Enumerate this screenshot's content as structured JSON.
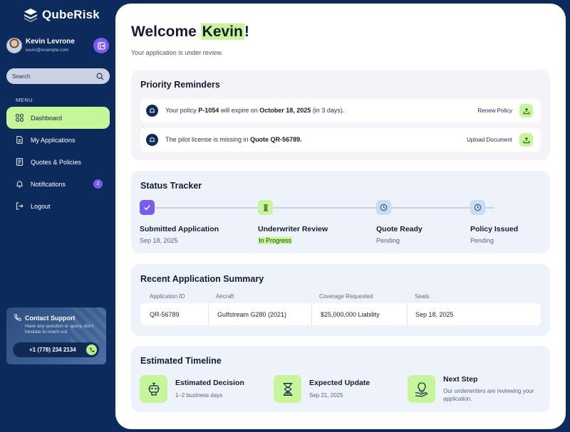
{
  "brand": {
    "name": "QubeRisk"
  },
  "user": {
    "name": "Kevin Levrone",
    "email": "kevin@example.com"
  },
  "search": {
    "placeholder": "Search"
  },
  "menu": {
    "label": "MENU",
    "items": [
      {
        "label": "Dashboard",
        "icon": "grid-icon",
        "active": true
      },
      {
        "label": "My Applications",
        "icon": "document-icon"
      },
      {
        "label": "Quotes & Policies",
        "icon": "document-list-icon"
      },
      {
        "label": "Notifications",
        "icon": "bell-icon",
        "badge": "2"
      },
      {
        "label": "Logout",
        "icon": "logout-icon"
      }
    ]
  },
  "support": {
    "title": "Contact Support",
    "text": "Have any question or query, don't hesitate to reach out.",
    "phone": "+1 (778) 234 2134"
  },
  "header": {
    "welcome_prefix": "Welcome ",
    "welcome_name": "Kevin",
    "welcome_suffix": "!",
    "subtitle": "Your application is under review."
  },
  "reminders": {
    "title": "Priority Reminders",
    "items": [
      {
        "t1": "Your policy ",
        "b1": "P-1054",
        "t2": " will expire on ",
        "b2": "October 18, 2025",
        "t3": " (in 3 days).",
        "action": "Renew Policy"
      },
      {
        "t1": "The pilot license is missing in ",
        "b1": "Quote QR-56789.",
        "t2": "",
        "b2": "",
        "t3": "",
        "action": "Upload Document"
      }
    ]
  },
  "tracker": {
    "title": "Status Tracker",
    "steps": [
      {
        "name": "Submitted Application",
        "sub": "Sep 18, 2025",
        "state": "done"
      },
      {
        "name": "Underwriter Review",
        "sub": "In Progress",
        "state": "progress"
      },
      {
        "name": "Quote Ready",
        "sub": "Pending",
        "state": "pending"
      },
      {
        "name": "Policy Issued",
        "sub": "Pending",
        "state": "pending"
      }
    ]
  },
  "summary": {
    "title": "Recent Application Summary",
    "columns": [
      "Application ID",
      "Aircraft",
      "Coverage Requested",
      "Seats"
    ],
    "row": [
      "QR-56789",
      "Gulfstream G280 (2021)",
      "$25,000,000 Liability",
      "Sep 18, 2025"
    ]
  },
  "timeline": {
    "title": "Estimated Timeline",
    "items": [
      {
        "name": "Estimated Decision",
        "sub": "1–2 business days",
        "icon": "robot-icon"
      },
      {
        "name": "Expected Update",
        "sub": "Sep 21, 2025",
        "icon": "hourglass-icon"
      },
      {
        "name": "Next Step",
        "sub": "Our underwriters are reviewing your application.",
        "icon": "lightbulb-hand-icon"
      }
    ]
  },
  "colors": {
    "accent_green": "#c6f59a",
    "purple": "#7b5cf0",
    "navy": "#0d2a5c"
  }
}
